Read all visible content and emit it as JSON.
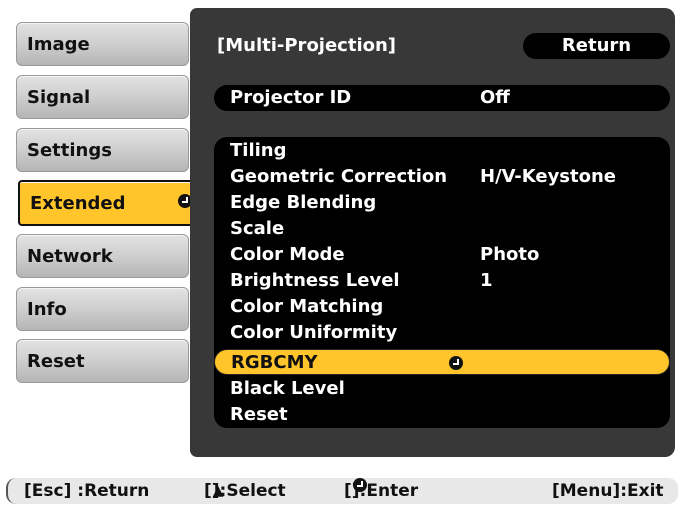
{
  "sidebar": {
    "items": [
      {
        "label": "Image"
      },
      {
        "label": "Signal"
      },
      {
        "label": "Settings"
      },
      {
        "label": "Extended"
      },
      {
        "label": "Network"
      },
      {
        "label": "Info"
      },
      {
        "label": "Reset"
      }
    ],
    "active_index": 3
  },
  "panel": {
    "title": "[Multi-Projection]",
    "return_label": "Return",
    "projector_id": {
      "label": "Projector ID",
      "value": "Off"
    },
    "items": [
      {
        "label": "Tiling",
        "value": ""
      },
      {
        "label": "Geometric Correction",
        "value": "H/V-Keystone"
      },
      {
        "label": "Edge Blending",
        "value": ""
      },
      {
        "label": "Scale",
        "value": ""
      },
      {
        "label": "Color Mode",
        "value": "Photo"
      },
      {
        "label": "Brightness Level",
        "value": "1"
      },
      {
        "label": "Color Matching",
        "value": ""
      },
      {
        "label": "Color Uniformity",
        "value": ""
      },
      {
        "label": "RGBCMY",
        "value": ""
      },
      {
        "label": "Black Level",
        "value": ""
      },
      {
        "label": "Reset",
        "value": ""
      }
    ],
    "selected_index": 8
  },
  "footer": {
    "esc": "[Esc] :Return",
    "select_pre": "[",
    "select_post": "]:Select",
    "enter_pre": "[",
    "enter_post": "]:Enter",
    "menu": "[Menu]:Exit"
  },
  "colors": {
    "accent": "#ffc52a",
    "panel": "#383838",
    "pill": "#000000"
  }
}
